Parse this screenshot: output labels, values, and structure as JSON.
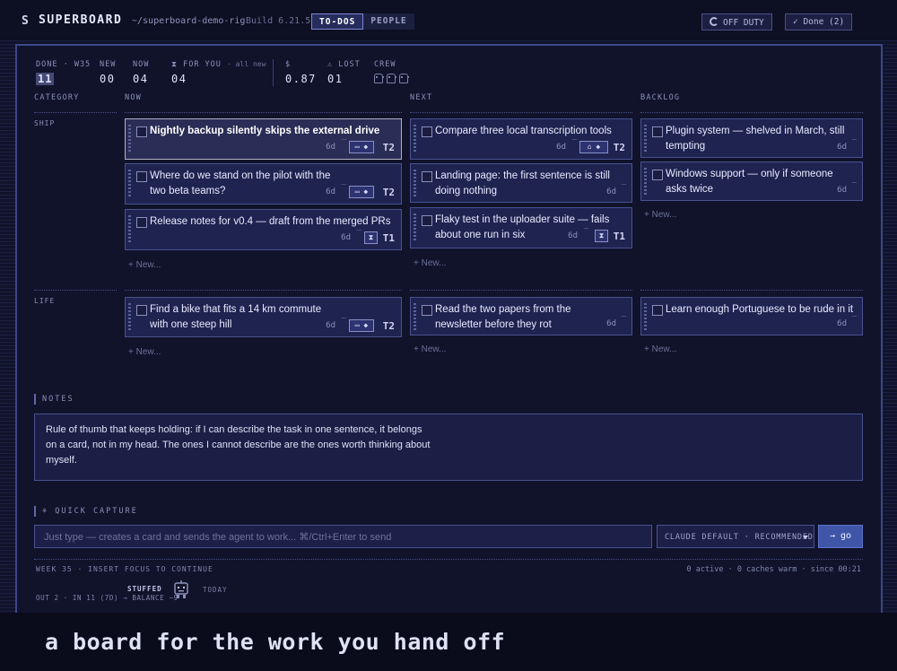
{
  "header": {
    "logo_glyph": "S",
    "title": "SUPERBOARD",
    "path": "~/superboard-demo-rig",
    "build": "Build 6.21.5",
    "tabs": [
      {
        "label": "TO-DOS",
        "active": true
      },
      {
        "label": "PEOPLE",
        "active": false
      }
    ],
    "off_duty_label": "OFF DUTY",
    "done_label": "✓ Done (2)"
  },
  "stats": {
    "done": {
      "label": "DONE · W35",
      "value": "11"
    },
    "new": {
      "label": "NEW",
      "value": "00"
    },
    "now": {
      "label": "NOW",
      "value": "04"
    },
    "for_you": {
      "label": "⧗ FOR YOU",
      "sub": "· all new",
      "value": "04"
    },
    "money": {
      "label": "$",
      "value": "0.87"
    },
    "lost": {
      "label": "⚠ LOST",
      "value": "01"
    },
    "crew": {
      "label": "CREW",
      "count": 3,
      "icon": "robot-icon"
    }
  },
  "columns": {
    "category": "CATEGORY",
    "now": "NOW",
    "next": "NEXT",
    "backlog": "BACKLOG"
  },
  "categories": [
    {
      "name": "SHIP",
      "now": [
        {
          "title": "Nightly backup silently skips the external drive",
          "age": "6d",
          "flag": "‾",
          "badge": "▭ ◆",
          "agent": "T2",
          "selected": true
        },
        {
          "title": "Where do we stand on the pilot with the two beta teams?",
          "age": "6d",
          "flag": "‾",
          "badge": "▭ ◆",
          "agent": "T2"
        },
        {
          "title": "Release notes for v0.4 — draft from the merged PRs",
          "age": "6d",
          "flag": "‾",
          "badge": "⧗",
          "agent": "T1"
        }
      ],
      "next": [
        {
          "title": "Compare three local transcription tools",
          "age": "6d",
          "flag": "‾",
          "badge": "⌂ ◆",
          "agent": "T2"
        },
        {
          "title": "Landing page: the first sentence is still doing nothing",
          "age": "6d",
          "flag": "‾"
        },
        {
          "title": "Flaky test in the uploader suite — fails about one run in six",
          "age": "6d",
          "flag": "‾",
          "badge": "⧗",
          "agent": "T1"
        }
      ],
      "backlog": [
        {
          "title": "Plugin system — shelved in March, still tempting",
          "age": "6d",
          "flag": "‾"
        },
        {
          "title": "Windows support — only if someone asks twice",
          "age": "6d",
          "flag": "‾"
        }
      ]
    },
    {
      "name": "LIFE",
      "now": [
        {
          "title": "Find a bike that fits a 14 km commute with one steep hill",
          "age": "6d",
          "flag": "‾",
          "badge": "▭ ◆",
          "agent": "T2"
        }
      ],
      "next": [
        {
          "title": "Read the two papers from the newsletter before they rot",
          "age": "6d",
          "flag": "‾"
        }
      ],
      "backlog": [
        {
          "title": "Learn enough Portuguese to be rude in it",
          "age": "6d",
          "flag": "‾"
        }
      ]
    }
  ],
  "new_label": "+ New...",
  "notes": {
    "label": "NOTES",
    "text": "Rule of thumb that keeps holding: if I can describe the task in one sentence, it belongs on a card, not in my head. The ones I cannot describe are the ones worth thinking about myself."
  },
  "quick_capture": {
    "label": "⚘ QUICK CAPTURE",
    "placeholder": "Just type — creates a card and sends the agent to work... ⌘/Ctrl+Enter to send",
    "model": "CLAUDE DEFAULT · RECOMMENDED",
    "go": "→ go"
  },
  "footer": {
    "left": "WEEK 35 · INSERT FOCUS TO CONTINUE",
    "right": "0 active · 0 caches warm · since 00:21",
    "sub": "OUT 2 · IN 11 (7D) → BALANCE −9",
    "mood": "STUFFED",
    "today": "TODAY"
  },
  "caption": "a board for the work you hand off"
}
